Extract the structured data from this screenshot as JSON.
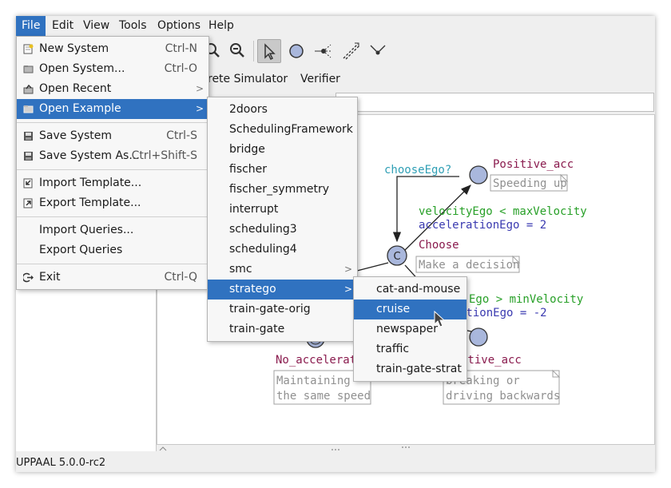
{
  "menubar": {
    "items": [
      {
        "label": "File",
        "active": true
      },
      {
        "label": "Edit"
      },
      {
        "label": "View"
      },
      {
        "label": "Tools"
      },
      {
        "label": "Options"
      },
      {
        "label": "Help"
      }
    ]
  },
  "tabs": {
    "simulator": "rete Simulator",
    "verifier": "Verifier"
  },
  "file_menu": {
    "new_system": {
      "label": "New System",
      "shortcut": "Ctrl-N"
    },
    "open_system": {
      "label": "Open System...",
      "shortcut": "Ctrl-O"
    },
    "open_recent": {
      "label": "Open Recent"
    },
    "open_example": {
      "label": "Open Example"
    },
    "save_system": {
      "label": "Save System",
      "shortcut": "Ctrl-S"
    },
    "save_system_as": {
      "label": "Save System As...",
      "shortcut": "Ctrl+Shift-S"
    },
    "import_template": {
      "label": "Import Template..."
    },
    "export_template": {
      "label": "Export Template..."
    },
    "import_queries": {
      "label": "Import Queries..."
    },
    "export_queries": {
      "label": "Export Queries"
    },
    "exit": {
      "label": "Exit",
      "shortcut": "Ctrl-Q"
    }
  },
  "example_menu": {
    "items": [
      "2doors",
      "SchedulingFramework",
      "bridge",
      "fischer",
      "fischer_symmetry",
      "interrupt",
      "scheduling3",
      "scheduling4",
      "smc",
      "stratego",
      "train-gate-orig",
      "train-gate"
    ],
    "highlighted": "stratego"
  },
  "stratego_menu": {
    "items": [
      "cat-and-mouse",
      "cruise",
      "newspaper",
      "traffic",
      "train-gate-strat"
    ],
    "highlighted": "cruise"
  },
  "canvas": {
    "choose_ego": "chooseEgo?",
    "positive_acc": "Positive_acc",
    "speeding_up": "Speeding up",
    "guard_up": "velocityEgo < maxVelocity",
    "update_up": "accelerationEgo = 2",
    "choose": "Choose",
    "make_decision": "Make a decision",
    "guard_down": "Ego > minVelocity",
    "update_down": "ationEgo = -2",
    "no_acceleration": "No_accelerati",
    "maintaining_1": "Maintaining",
    "maintaining_2": "the same speed",
    "negative_acc": "ative_acc",
    "breaking_1": "breaking or",
    "breaking_2": "driving backwards",
    "committed_mark": "C"
  },
  "colors": {
    "accent": "#3072c0",
    "location_name": "#8a1b4e",
    "sync": "#2f9fb5",
    "guard": "#28a028",
    "update": "#3a3ab0",
    "comment": "#909090",
    "location_fill": "#a9b7dc"
  },
  "status": {
    "version": "UPPAAL 5.0.0-rc2"
  }
}
